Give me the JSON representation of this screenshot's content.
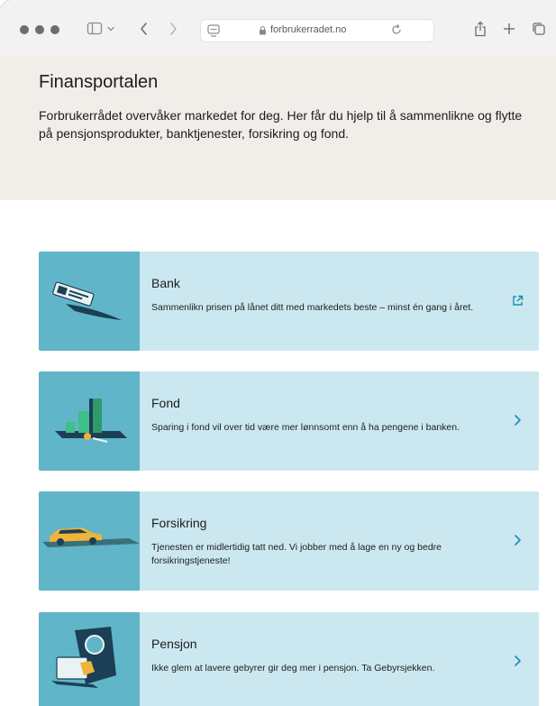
{
  "browser": {
    "url": "forbrukerradet.no"
  },
  "hero": {
    "title": "Finansportalen",
    "text": "Forbrukerrådet overvåker markedet for deg. Her får du hjelp til å sammenlikne og flytte på pensjonsprodukter, banktjenester, forsikring og fond."
  },
  "cards": [
    {
      "title": "Bank",
      "desc": "Sammenlikn prisen på lånet ditt med markedets beste – minst én gang i året.",
      "icon": "external-link-icon"
    },
    {
      "title": "Fond",
      "desc": "Sparing i fond vil over tid være mer lønnsomt enn å ha pengene i banken.",
      "icon": "chevron-right-icon"
    },
    {
      "title": "Forsikring",
      "desc": "Tjenesten er midlertidig tatt ned. Vi jobber med å lage en ny og bedre forsikringstjeneste!",
      "icon": "chevron-right-icon"
    },
    {
      "title": "Pensjon",
      "desc": "Ikke glem at lavere gebyrer gir deg mer i pensjon. Ta Gebyrsjekken.",
      "icon": "chevron-right-icon"
    }
  ],
  "colors": {
    "accent": "#1a8fb0",
    "card_bg": "#cbe8f0",
    "illustration_bg": "#60b5c8",
    "hero_bg": "#f1ede8"
  }
}
